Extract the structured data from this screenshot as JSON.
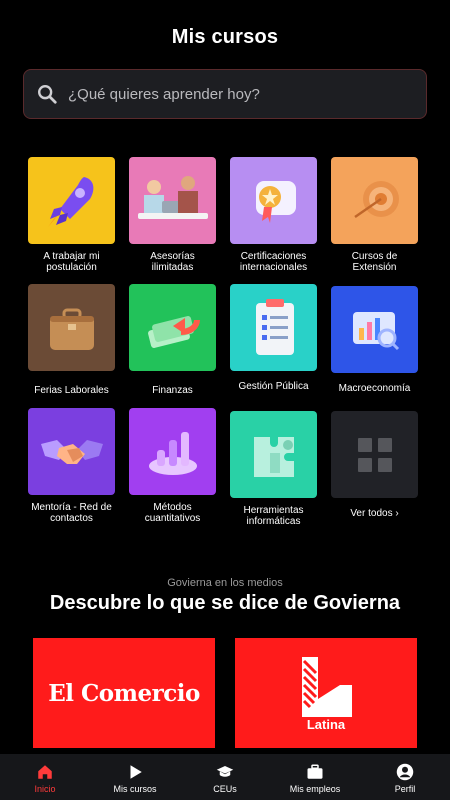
{
  "header": {
    "title": "Mis cursos"
  },
  "search": {
    "placeholder": "¿Qué quieres aprender hoy?"
  },
  "categories": [
    {
      "label": "A trabajar mi postulación",
      "color": "#f6c31b",
      "icon": "rocket-icon"
    },
    {
      "label": "Asesorías ilimitadas",
      "color": "#e87ab7",
      "icon": "people-meeting-icon"
    },
    {
      "label": "Certificaciones internacionales",
      "color": "#b78ef2",
      "icon": "certificate-badge-icon"
    },
    {
      "label": "Cursos de Extensión",
      "color": "#f4a35b",
      "icon": "target-icon"
    },
    {
      "label": "Ferias Laborales",
      "color": "#6b4b36",
      "icon": "briefcase-icon"
    },
    {
      "label": "Finanzas",
      "color": "#22c25a",
      "icon": "money-icon"
    },
    {
      "label": "Gestión Pública",
      "color": "#29d1c8",
      "icon": "clipboard-icon"
    },
    {
      "label": "Macroeconomía",
      "color": "#2e55e8",
      "icon": "chart-board-icon"
    },
    {
      "label": "Mentoría - Red de contactos",
      "color": "#7b3fe0",
      "icon": "handshake-icon"
    },
    {
      "label": "Métodos cuantitativos",
      "color": "#a13ff0",
      "icon": "bar-chart-icon"
    },
    {
      "label": "Herramientas informáticas",
      "color": "#29d1a6",
      "icon": "puzzle-icon"
    },
    {
      "label": "Ver todos ›",
      "color": "#212227",
      "icon": "grid-icon"
    }
  ],
  "media": {
    "subtitle": "Govierna en los medios",
    "title": "Descubre lo que se dice de Govierna",
    "logos": [
      {
        "text": "El Comercio"
      },
      {
        "text": "Latina"
      }
    ]
  },
  "nav": [
    {
      "label": "Inicio",
      "icon": "home-icon",
      "active": true
    },
    {
      "label": "Mis cursos",
      "icon": "play-icon"
    },
    {
      "label": "CEUs",
      "icon": "graduation-cap-icon"
    },
    {
      "label": "Mis empleos",
      "icon": "briefcase-icon"
    },
    {
      "label": "Perfil",
      "icon": "user-icon"
    }
  ],
  "colors": {
    "accent": "#ff3b3b",
    "brand_red": "#ff1b1b",
    "background": "#000000"
  }
}
